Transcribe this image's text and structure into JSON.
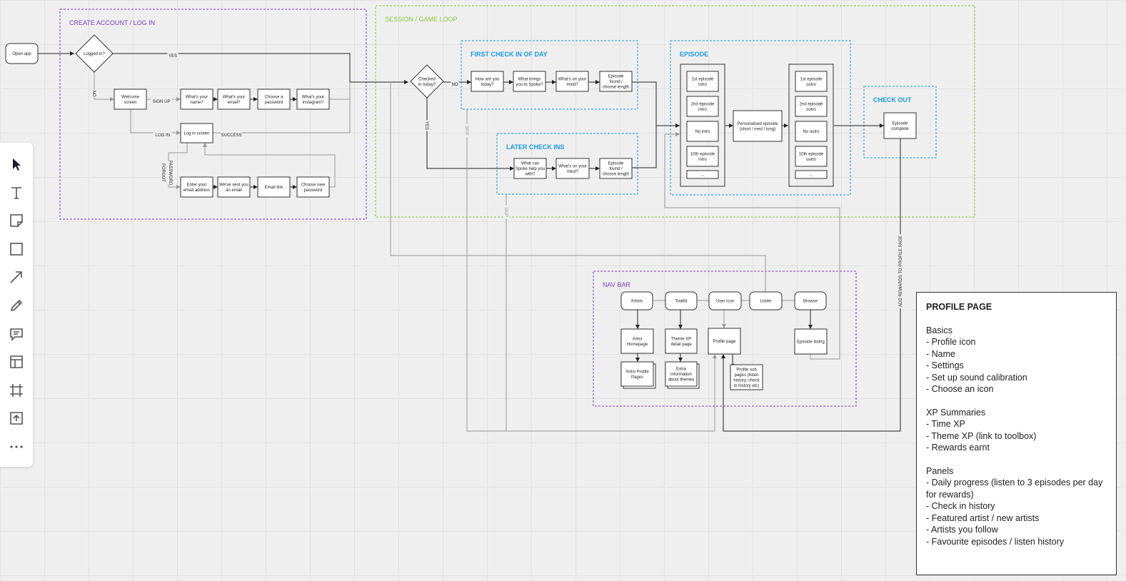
{
  "toolbar": {
    "tools": [
      {
        "icon": "cursor-icon",
        "name": "select"
      },
      {
        "icon": "text-icon",
        "name": "text"
      },
      {
        "icon": "sticky-note-icon",
        "name": "sticky-note"
      },
      {
        "icon": "shape-icon",
        "name": "shape"
      },
      {
        "icon": "arrow-icon",
        "name": "connection-line"
      },
      {
        "icon": "pen-icon",
        "name": "pen"
      },
      {
        "icon": "comment-icon",
        "name": "comment"
      },
      {
        "icon": "template-icon",
        "name": "template"
      },
      {
        "icon": "frame-icon",
        "name": "frame"
      },
      {
        "icon": "upload-icon",
        "name": "upload"
      },
      {
        "icon": "more-icon",
        "name": "more"
      }
    ]
  },
  "colors": {
    "frame_purple": "#7b3fc4",
    "frame_green": "#8cc63f",
    "frame_blue": "#1a9be0",
    "line_dark": "#222222",
    "line_gray": "#999999"
  },
  "diagram": {
    "frames": [
      {
        "id": "create-account",
        "label": "CREATE ACCOUNT / LOG IN",
        "color": "purple"
      },
      {
        "id": "session",
        "label": "SESSION / GAME LOOP",
        "color": "green"
      },
      {
        "id": "first-check-in",
        "label": "FIRST CHECK IN OF DAY",
        "color": "blue"
      },
      {
        "id": "later-check-ins",
        "label": "LATER CHECK INS",
        "color": "blue"
      },
      {
        "id": "episode",
        "label": "EPISODE",
        "color": "blue"
      },
      {
        "id": "check-out",
        "label": "CHECK OUT",
        "color": "blue"
      },
      {
        "id": "nav-bar",
        "label": "NAV BAR",
        "color": "purple"
      }
    ],
    "nodes": {
      "open-app": [
        "Open app"
      ],
      "logged-in": [
        "Logged in?"
      ],
      "welcome": [
        "Welcome",
        "screen"
      ],
      "name": [
        "What's your",
        "name?"
      ],
      "email": [
        "What's your",
        "email?"
      ],
      "password": [
        "Choose a",
        "password"
      ],
      "instagram": [
        "What's your",
        "instagram?"
      ],
      "login-screen": [
        "Log in screen"
      ],
      "enter-email": [
        "Enter your",
        "email address"
      ],
      "sent-email": [
        "We've sent you",
        "an email"
      ],
      "email-link": [
        "Email link"
      ],
      "new-password": [
        "Choose new",
        "password"
      ],
      "checked-in": [
        "Checked",
        "in today?"
      ],
      "how-are-you": [
        "How are you",
        "today?"
      ],
      "what-brings": [
        "What brings",
        "you to Spoke?"
      ],
      "on-mind-1": [
        "What's on your",
        "mind?"
      ],
      "episode-found-1": [
        "Episode",
        "found /",
        "choose length"
      ],
      "spoke-help": [
        "What can",
        "Spoke help you",
        "with?"
      ],
      "on-mind-2": [
        "What's on your",
        "mind?"
      ],
      "episode-found-2": [
        "Episode",
        "found /",
        "choose length"
      ],
      "intro-1": [
        "1st episode",
        "intro"
      ],
      "intro-2": [
        "2nd episode",
        "intro"
      ],
      "intro-none": [
        "No intro"
      ],
      "intro-10": [
        "10th episode",
        "intro"
      ],
      "intro-more": [
        "..."
      ],
      "personalised": [
        "Personalised episode",
        "(short / med / long)"
      ],
      "outro-1": [
        "1st episode",
        "outro"
      ],
      "outro-2": [
        "2nd episode",
        "outro"
      ],
      "outro-none": [
        "No outro"
      ],
      "outro-10": [
        "10th episode",
        "outro"
      ],
      "outro-more": [
        "..."
      ],
      "episode-complete": [
        "Episode",
        "complete"
      ],
      "nav-artists": [
        "Artists"
      ],
      "nav-toolkit": [
        "Toolkit"
      ],
      "nav-user": [
        "User icon"
      ],
      "nav-listen": [
        "Listen"
      ],
      "nav-browse": [
        "Browse"
      ],
      "artist-homepage": [
        "Artist",
        "Homepage"
      ],
      "theme-xp": [
        "Theme XP",
        "detail page"
      ],
      "profile-page": [
        "Profile page"
      ],
      "episode-listing": [
        "Episode listing"
      ],
      "artist-profiles": [
        "Artist Profile",
        "Pages"
      ],
      "extra-info": [
        "Extra",
        "information",
        "about themes"
      ],
      "profile-sub": [
        "Profile sub",
        "pages (listen",
        "history, check",
        "in history etc)"
      ]
    },
    "edge_labels": {
      "yes_1": "YES",
      "no_1": "NO",
      "sign_up": "SIGN UP",
      "log_in": "LOG IN",
      "success": "SUCCESS",
      "forgot": "FORGOT",
      "password": "PASSWORD",
      "no_2": "NO",
      "yes_2": "YES",
      "skip_1": "SKIP",
      "skip_2": "SKIP",
      "add_rewards": "ADD REWARDS TO PROFILE PAGE"
    }
  },
  "profile_page": {
    "title": "PROFILE PAGE",
    "sections": [
      {
        "heading": "Basics",
        "items": [
          "- Profile icon",
          "- Name",
          "- Settings",
          "- Set up sound calibration",
          "- Choose an icon"
        ]
      },
      {
        "heading": "XP Summaries",
        "items": [
          "- Time XP",
          "- Theme XP (link to toolbox)",
          "- Rewards earnt"
        ]
      },
      {
        "heading": "Panels",
        "items": [
          "- Daily progress (listen to 3 episodes per day for rewards)",
          "- Check in history",
          "- Featured artist / new artists",
          "- Artists you follow",
          "- Favourite episodes / listen history"
        ]
      }
    ]
  }
}
